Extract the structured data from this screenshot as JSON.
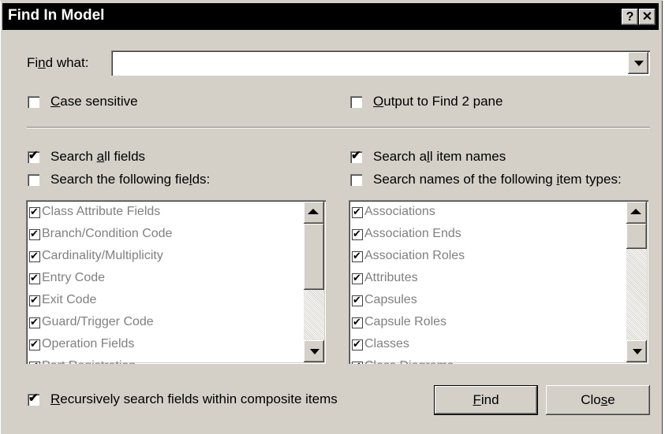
{
  "window": {
    "title": "Find In Model",
    "help_label": "?",
    "close_label": "✕"
  },
  "find_what": {
    "label_pre": "Fi",
    "label_key": "n",
    "label_post": "d what:",
    "value": ""
  },
  "case_sensitive": {
    "pre": "",
    "key": "C",
    "post": "ase sensitive",
    "checked": false
  },
  "output_find2": {
    "pre": "",
    "key": "O",
    "post": "utput to Find 2 pane",
    "checked": false
  },
  "search_all_fields": {
    "pre": "Search ",
    "key": "a",
    "post": "ll fields",
    "checked": true
  },
  "search_following_fields": {
    "pre": "Search the following fie",
    "key": "l",
    "post": "ds:",
    "checked": false
  },
  "search_all_names": {
    "pre": "Search a",
    "key": "l",
    "post": "l item names",
    "checked": true
  },
  "search_names_types": {
    "pre": "Search names of the following ",
    "key": "i",
    "post": "tem types:",
    "checked": false
  },
  "fields_list": [
    "Class Attribute Fields",
    "Branch/Condition Code",
    "Cardinality/Multiplicity",
    "Entry Code",
    "Exit Code",
    "Guard/Trigger Code",
    "Operation Fields",
    "Port Registration"
  ],
  "types_list": [
    "Associations",
    "Association Ends",
    "Association Roles",
    "Attributes",
    "Capsules",
    "Capsule Roles",
    "Classes",
    "Class Diagrams"
  ],
  "recursive": {
    "pre": "",
    "key": "R",
    "post": "ecursively search fields within composite items",
    "checked": true
  },
  "find_button": {
    "pre": "",
    "key": "F",
    "post": "ind"
  },
  "close_button": {
    "pre": "Clo",
    "key": "s",
    "post": "e"
  },
  "check_glyph": "✔"
}
